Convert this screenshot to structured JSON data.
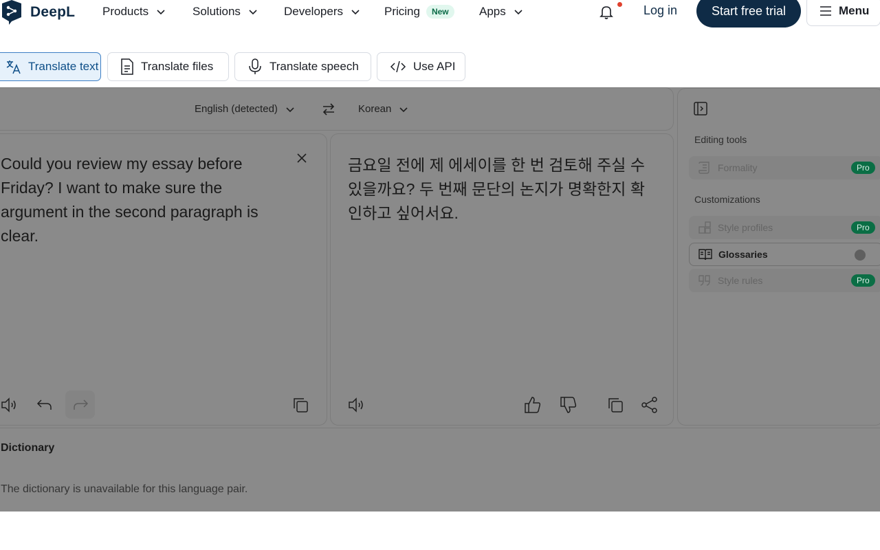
{
  "brand": {
    "name": "DeepL"
  },
  "nav": {
    "items": [
      {
        "label": "Products"
      },
      {
        "label": "Solutions"
      },
      {
        "label": "Developers"
      },
      {
        "label": "Pricing",
        "badge": "New"
      },
      {
        "label": "Apps"
      }
    ],
    "login": "Log in",
    "trial": "Start free trial",
    "menu": "Menu"
  },
  "modes": [
    {
      "label": "Translate text",
      "active": true
    },
    {
      "label": "Translate files"
    },
    {
      "label": "Translate speech"
    },
    {
      "label": "Use API"
    }
  ],
  "translator": {
    "source_lang": "English (detected)",
    "target_lang": "Korean",
    "source_text": "Could you review my essay before Friday? I want to make sure the argument in the second paragraph is clear.",
    "target_text": "금요일 전에 제 에세이를 한 번 검토해 주실 수 있을까요? 두 번째 문단의 논지가 명확한지 확인하고 싶어서요."
  },
  "sidebar": {
    "editing_heading": "Editing tools",
    "formality": "Formality",
    "customizations_heading": "Customizations",
    "style_profiles": "Style profiles",
    "glossaries": "Glossaries",
    "style_rules": "Style rules",
    "pro_label": "Pro"
  },
  "dictionary": {
    "title": "Dictionary",
    "message": "The dictionary is unavailable for this language pair."
  },
  "colors": {
    "brand_navy": "#0f2b46",
    "pro_green": "#0b6e45",
    "overlay": "#8a8a8a"
  }
}
